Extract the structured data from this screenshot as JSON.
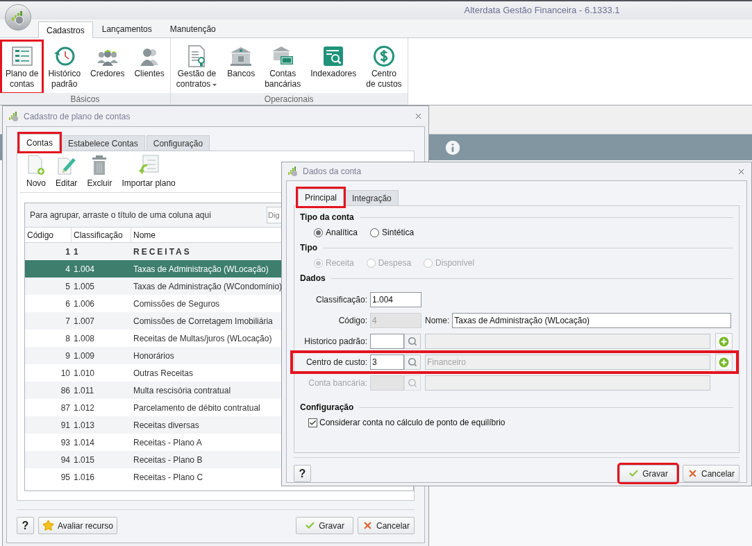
{
  "app": {
    "title": "Alterdata Gestão Financeira - 6.1333.1"
  },
  "ribbon": {
    "tabs": [
      {
        "label": "Cadastros",
        "selected": true
      },
      {
        "label": "Lançamentos",
        "selected": false
      },
      {
        "label": "Manutenção",
        "selected": false
      }
    ],
    "groups": [
      {
        "label": "Básicos",
        "buttons": [
          {
            "lines": [
              "Plano de",
              "contas"
            ],
            "dropdown": false,
            "highlighted": true
          },
          {
            "lines": [
              "Histórico",
              "padrão"
            ],
            "dropdown": false,
            "highlighted": false
          },
          {
            "lines": [
              "Credores"
            ],
            "dropdown": false,
            "highlighted": false
          },
          {
            "lines": [
              "Clientes"
            ],
            "dropdown": false,
            "highlighted": false
          }
        ]
      },
      {
        "label": "Operacionais",
        "buttons": [
          {
            "lines": [
              "Gestão de",
              "contratos"
            ],
            "dropdown": true,
            "highlighted": false
          },
          {
            "lines": [
              "Bancos"
            ],
            "dropdown": false,
            "highlighted": false
          },
          {
            "lines": [
              "Contas",
              "bancárias"
            ],
            "dropdown": false,
            "highlighted": false
          },
          {
            "lines": [
              "Indexadores"
            ],
            "dropdown": false,
            "highlighted": false
          },
          {
            "lines": [
              "Centro",
              "de custos"
            ],
            "dropdown": false,
            "highlighted": false
          }
        ]
      }
    ]
  },
  "plan_dialog": {
    "title": "Cadastro de plano de contas",
    "tabs": [
      {
        "label": "Contas",
        "selected": true,
        "highlighted": true
      },
      {
        "label": "Estabelece Contas",
        "selected": false,
        "highlighted": false
      },
      {
        "label": "Configuração",
        "selected": false,
        "highlighted": false
      }
    ],
    "toolbar": [
      {
        "label": "Novo"
      },
      {
        "label": "Editar"
      },
      {
        "label": "Excluir"
      },
      {
        "label": "Importar plano"
      }
    ],
    "group_hint": "Para agrupar, arraste o título de uma coluna aqui",
    "search": {
      "placeholder": "Dig"
    },
    "columns": [
      "Código",
      "Classificação",
      "Nome"
    ],
    "rows": [
      {
        "kind": "group",
        "code": "1",
        "classification": "1",
        "name": "RECEITAS",
        "selected": false
      },
      {
        "kind": "account",
        "code": "4",
        "classification": "1.004",
        "name": "Taxas de Administração (WLocação)",
        "selected": true
      },
      {
        "kind": "account",
        "code": "5",
        "classification": "1.005",
        "name": "Taxas de Administração (WCondomínio)",
        "selected": false
      },
      {
        "kind": "account",
        "code": "6",
        "classification": "1.006",
        "name": "Comissões de Seguros",
        "selected": false
      },
      {
        "kind": "account",
        "code": "7",
        "classification": "1.007",
        "name": "Comissões de Corretagem Imobiliária",
        "selected": false
      },
      {
        "kind": "account",
        "code": "8",
        "classification": "1.008",
        "name": "Receitas de Multas/juros (WLocação)",
        "selected": false
      },
      {
        "kind": "account",
        "code": "9",
        "classification": "1.009",
        "name": "Honorários",
        "selected": false
      },
      {
        "kind": "account",
        "code": "10",
        "classification": "1.010",
        "name": "Outras Receitas",
        "selected": false
      },
      {
        "kind": "account",
        "code": "86",
        "classification": "1.011",
        "name": "Multa rescisória contratual",
        "selected": false
      },
      {
        "kind": "account",
        "code": "87",
        "classification": "1.012",
        "name": "Parcelamento de débito contratual",
        "selected": false
      },
      {
        "kind": "account",
        "code": "91",
        "classification": "1.013",
        "name": "Receitas diversas",
        "selected": false
      },
      {
        "kind": "account",
        "code": "93",
        "classification": "1.014",
        "name": "Receitas - Plano A",
        "selected": false
      },
      {
        "kind": "account",
        "code": "94",
        "classification": "1.015",
        "name": "Receitas - Plano B",
        "selected": false
      },
      {
        "kind": "account",
        "code": "95",
        "classification": "1.016",
        "name": "Receitas - Plano C",
        "selected": false
      }
    ],
    "buttons": [
      {
        "kind": "help",
        "label": "?",
        "highlighted": false
      },
      {
        "kind": "rate",
        "label": "Avaliar recurso",
        "highlighted": false
      },
      {
        "kind": "save",
        "label": "Gravar",
        "highlighted": false
      },
      {
        "kind": "cancel",
        "label": "Cancelar",
        "highlighted": false
      }
    ]
  },
  "account_dialog": {
    "title": "Dados da conta",
    "tabs": [
      {
        "label": "Principal",
        "selected": true,
        "highlighted": true
      },
      {
        "label": "Integração",
        "selected": false,
        "highlighted": false
      }
    ],
    "sections": [
      {
        "kind": "radios",
        "title": "Tipo da conta",
        "options": [
          {
            "label": "Analítica",
            "selected": true,
            "disabled": false
          },
          {
            "label": "Sintética",
            "selected": false,
            "disabled": false
          }
        ]
      },
      {
        "kind": "radios",
        "title": "Tipo",
        "options": [
          {
            "label": "Receita",
            "selected": true,
            "disabled": true
          },
          {
            "label": "Despesa",
            "selected": false,
            "disabled": true
          },
          {
            "label": "Disponível",
            "selected": false,
            "disabled": true
          }
        ]
      },
      {
        "kind": "fields",
        "title": "Dados",
        "fields": [
          {
            "kind": "text",
            "label": "Classificação:",
            "value": "1.004",
            "disabled": false,
            "highlighted": false
          },
          {
            "kind": "code_name",
            "label": "Código:",
            "value": "4",
            "disabled": true,
            "name_label": "Nome:",
            "name_value": "Taxas de Administração (WLocação)",
            "highlighted": false
          },
          {
            "kind": "lookup",
            "label": "Historico padrão:",
            "disabled": false,
            "add": true,
            "highlighted": false
          },
          {
            "kind": "lookup",
            "label": "Centro de custo:",
            "value": "3",
            "description": "Financeiro",
            "disabled": false,
            "add": true,
            "highlighted": true
          },
          {
            "kind": "lookup",
            "label": "Conta bancária:",
            "disabled": true,
            "add": false,
            "highlighted": false
          }
        ]
      },
      {
        "kind": "checkboxes",
        "title": "Configuração",
        "options": [
          {
            "label": "Considerar conta no cálculo de ponto de equilíbrio",
            "checked": true
          }
        ]
      }
    ],
    "buttons": [
      {
        "kind": "help",
        "label": "?",
        "highlighted": false
      },
      {
        "kind": "save",
        "label": "Gravar",
        "highlighted": true
      },
      {
        "kind": "cancel",
        "label": "Cancelar",
        "highlighted": false
      }
    ]
  }
}
